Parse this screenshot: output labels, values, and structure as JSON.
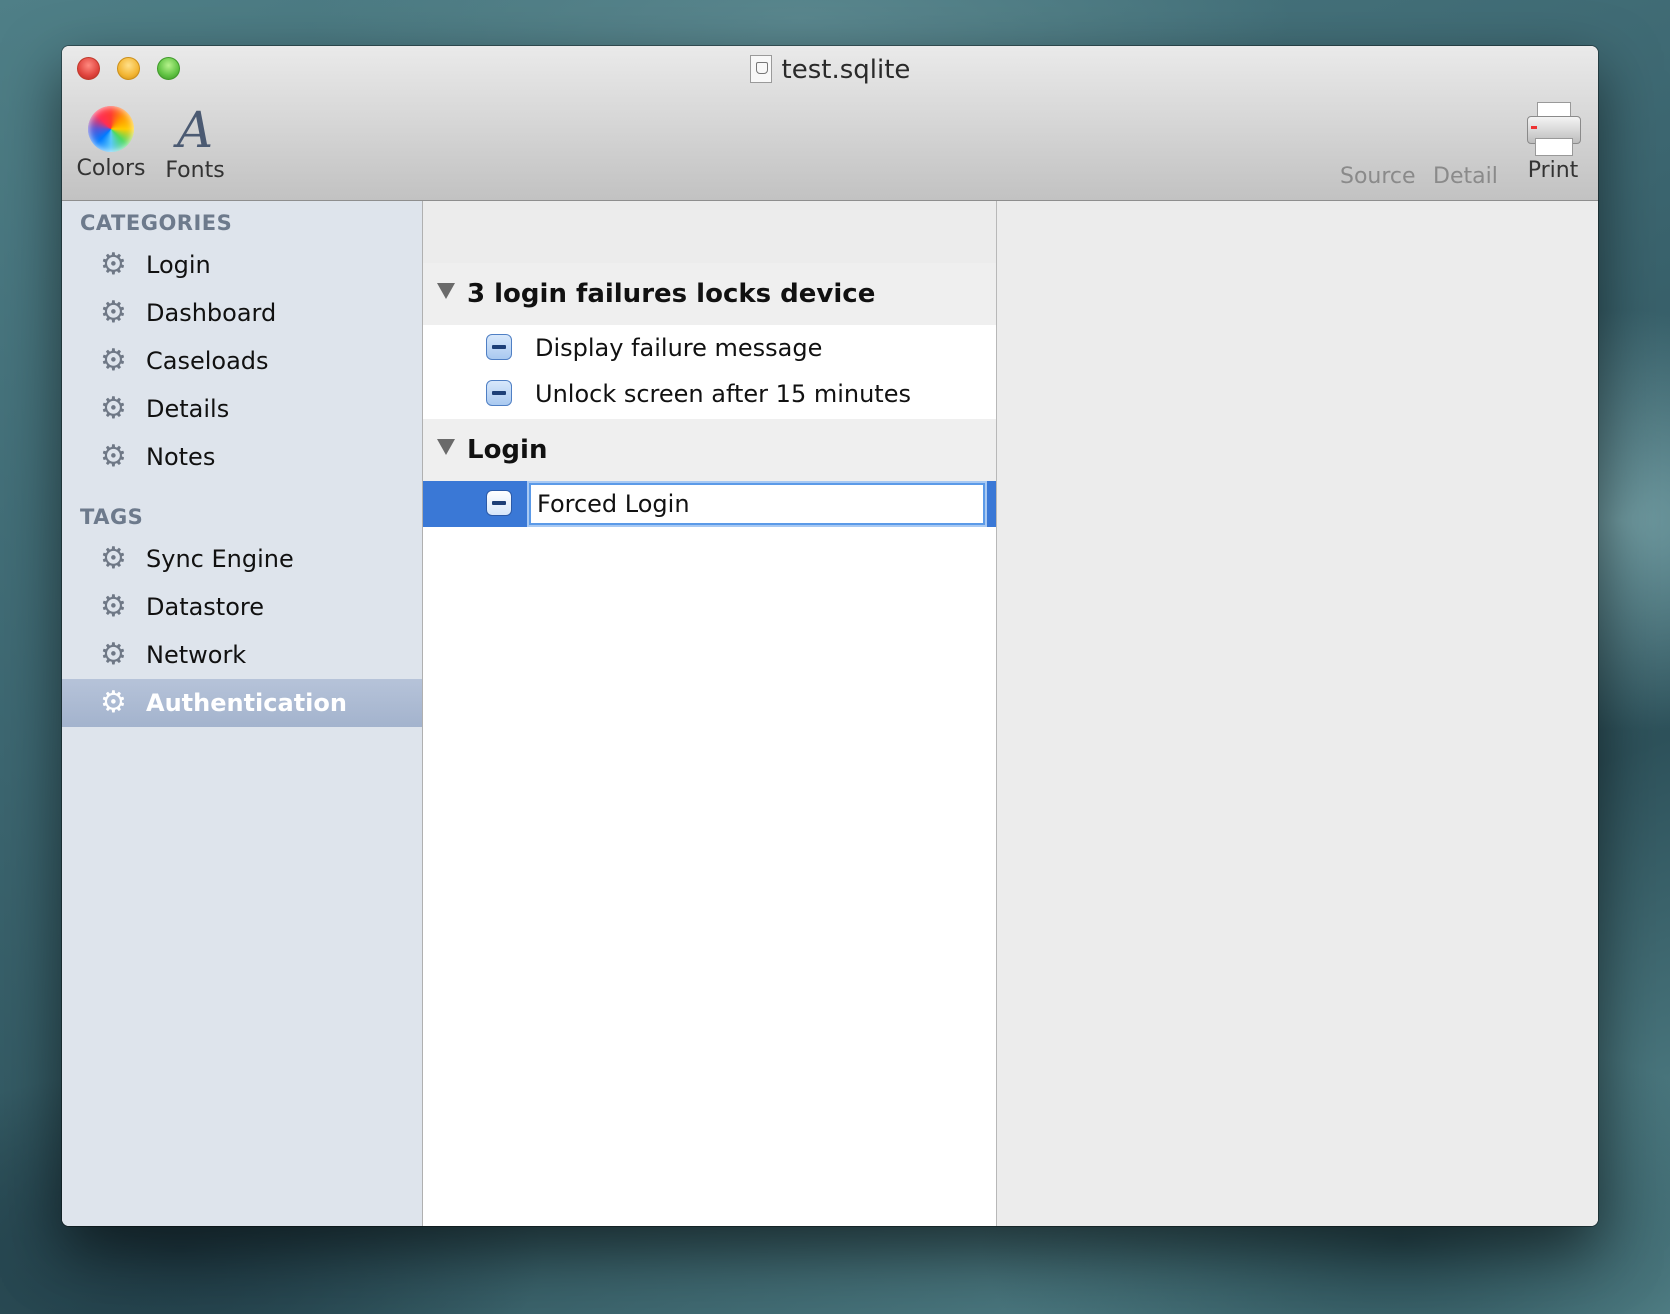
{
  "window": {
    "title": "test.sqlite"
  },
  "toolbar": {
    "colors_label": "Colors",
    "fonts_label": "Fonts",
    "source_label": "Source",
    "detail_label": "Detail",
    "print_label": "Print"
  },
  "sidebar": {
    "categories_heading": "CATEGORIES",
    "categories": [
      "Login",
      "Dashboard",
      "Caseloads",
      "Details",
      "Notes"
    ],
    "tags_heading": "TAGS",
    "tags": [
      "Sync Engine",
      "Datastore",
      "Network",
      "Authentication"
    ],
    "selected": "Authentication"
  },
  "outline": {
    "groups": [
      {
        "title": "3 login failures locks device",
        "items": [
          "Display failure message",
          "Unlock screen after 15 minutes"
        ]
      },
      {
        "title": "Login",
        "items": [
          "Forced Login"
        ]
      }
    ],
    "editing_value": "Forced Login"
  },
  "colors": {
    "selection": "#3a78d6",
    "sidebar_bg": "#dee4ec",
    "sidebar_selected": "#a3b3cd"
  },
  "icons": [
    "close-button",
    "minimize-button",
    "zoom-button",
    "sqlite-document-icon",
    "color-wheel-icon",
    "font-icon",
    "printer-icon",
    "gear-icon",
    "disclosure-triangle-icon",
    "mixed-checkbox-icon"
  ]
}
